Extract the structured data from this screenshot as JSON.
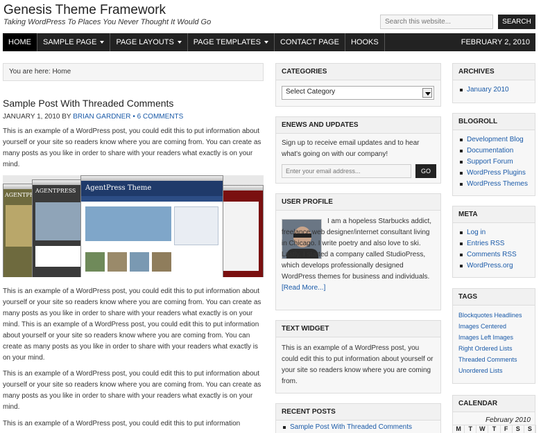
{
  "site": {
    "title": "Genesis Theme Framework",
    "description": "Taking WordPress To Places You Never Thought It Would Go"
  },
  "search": {
    "placeholder": "Search this website...",
    "button": "SEARCH"
  },
  "nav": {
    "items": [
      {
        "label": "HOME",
        "dropdown": false
      },
      {
        "label": "SAMPLE PAGE",
        "dropdown": true
      },
      {
        "label": "PAGE LAYOUTS",
        "dropdown": true
      },
      {
        "label": "PAGE TEMPLATES",
        "dropdown": true
      },
      {
        "label": "CONTACT PAGE",
        "dropdown": false
      },
      {
        "label": "HOOKS",
        "dropdown": false
      }
    ],
    "date": "FEBRUARY 2, 2010"
  },
  "breadcrumb": "You are here: Home",
  "post": {
    "title": "Sample Post With Threaded Comments",
    "date_by": "JANUARY 1, 2010 BY",
    "author": "BRIAN GARDNER",
    "separator": "•",
    "comments": "6 COMMENTS",
    "paragraphs": [
      "This is an example of a WordPress post, you could edit this to put information about yourself or your site so readers know where you are coming from. You can create as many posts as you like in order to share with your readers what exactly is on your mind.",
      "This is an example of a WordPress post, you could edit this to put information about yourself or your site so readers know where you are coming from. You can create as many posts as you like in order to share with your readers what exactly is on your mind. This is an example of a WordPress post, you could edit this to put information about yourself or your site so readers know where you are coming from. You can create as many posts as you like in order to share with your readers what exactly is on your mind.",
      "This is an example of a WordPress post, you could edit this to put information about yourself or your site so readers know where you are coming from. You can create as many posts as you like in order to share with your readers what exactly is on your mind.",
      "This is an example of a WordPress post, you could edit this to put information"
    ],
    "image_text": {
      "brand": "AgentPress Theme",
      "brand_short": "AGENTPRESS"
    }
  },
  "categories": {
    "title": "CATEGORIES",
    "selected": "Select Category"
  },
  "enews": {
    "title": "ENEWS AND UPDATES",
    "text": "Sign up to receive email updates and to hear what's going on with our company!",
    "placeholder": "Enter your email address...",
    "button": "GO"
  },
  "profile": {
    "title": "USER PROFILE",
    "text": "I am a hopeless Starbucks addict, freelance web designer/internet consultant living in Chicago. I write poetry and also love to ski. Lastly, I started a company called StudioPress, which develops professionally designed WordPress themes for business and individuals.",
    "more": "[Read More...]"
  },
  "text_widget": {
    "title": "TEXT WIDGET",
    "text": "This is an example of a WordPress post, you could edit this to put information about yourself or your site so readers know where you are coming from."
  },
  "recent": {
    "title": "RECENT POSTS",
    "items": [
      "Sample Post With Threaded Comments"
    ]
  },
  "archives": {
    "title": "ARCHIVES",
    "items": [
      "January 2010"
    ]
  },
  "blogroll": {
    "title": "BLOGROLL",
    "items": [
      "Development Blog",
      "Documentation",
      "Support Forum",
      "WordPress Plugins",
      "WordPress Themes"
    ]
  },
  "meta": {
    "title": "META",
    "items": [
      "Log in",
      "Entries RSS",
      "Comments RSS",
      "WordPress.org"
    ]
  },
  "tags": {
    "title": "TAGS",
    "items": [
      "Blockquotes Headlines",
      "Images Centered",
      "Images Left Images",
      "Right Ordered Lists",
      "Threaded Comments",
      "Unordered Lists"
    ]
  },
  "calendar": {
    "title": "CALENDAR",
    "month": "February 2010",
    "days": [
      "M",
      "T",
      "W",
      "T",
      "F",
      "S",
      "S"
    ]
  },
  "colors": {
    "accent": "#222222",
    "link": "#1a5aa8"
  }
}
